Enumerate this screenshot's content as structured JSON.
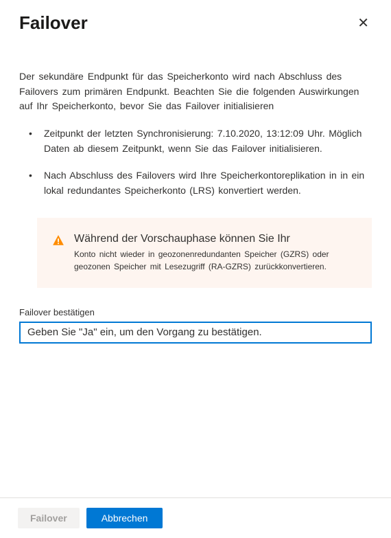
{
  "header": {
    "title": "Failover"
  },
  "intro": "Der sekundäre Endpunkt für das Speicherkonto wird nach Abschluss des Failovers zum primären Endpunkt. Beachten Sie die folgenden Auswirkungen auf Ihr Speicherkonto, bevor Sie das Failover initialisieren",
  "bullets": [
    "Zeitpunkt der letzten Synchronisierung: 7.10.2020, 13:12:09 Uhr. Möglich Daten ab diesem Zeitpunkt, wenn Sie das Failover initialisieren.",
    "Nach Abschluss des Failovers wird Ihre Speicherkontoreplikation in in ein lokal redundantes Speicherkonto (LRS) konvertiert werden."
  ],
  "warning": {
    "title": "Während der Vorschauphase können Sie Ihr",
    "body": "Konto nicht wieder in geozonenredundanten Speicher (GZRS) oder geozonen Speicher mit Lesezugriff (RA-GZRS) zurückkonvertieren."
  },
  "confirm": {
    "label": "Failover bestätigen",
    "placeholder": "Geben Sie \"Ja\" ein, um den Vorgang zu bestätigen."
  },
  "footer": {
    "failover_label": "Failover",
    "cancel_label": "Abbrechen"
  }
}
